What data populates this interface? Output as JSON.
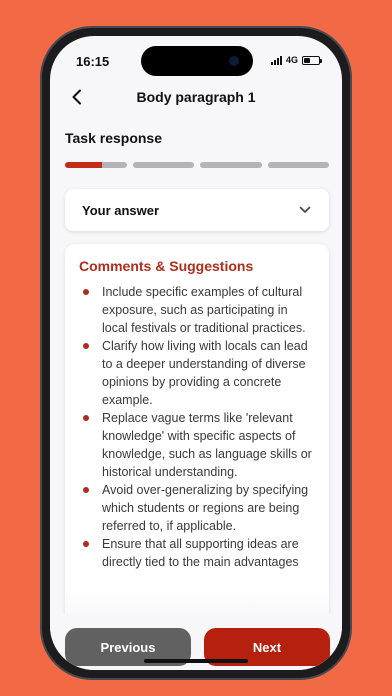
{
  "status_bar": {
    "time": "16:15",
    "network": "4G"
  },
  "header": {
    "title": "Body paragraph 1",
    "back_icon": "chevron-left-icon"
  },
  "section": {
    "label": "Task response",
    "progress": {
      "segments": 4,
      "current_segment": 1,
      "current_fill": 0.6,
      "colors": {
        "active": "#c42a18",
        "inactive": "#b3b4ba"
      }
    }
  },
  "answer": {
    "label": "Your answer",
    "toggle_icon": "chevron-down-icon"
  },
  "comments": {
    "title": "Comments & Suggestions",
    "items": [
      "Include specific examples of cultural exposure, such as participating in local festivals or traditional practices.",
      "Clarify how living with locals can lead to a deeper understanding of diverse opinions by providing a concrete example.",
      "Replace vague terms like 'relevant knowledge' with specific aspects of knowledge, such as language skills or historical understanding.",
      "Avoid over-generalizing by specifying which students or regions are being referred to, if applicable.",
      "Ensure that all supporting ideas are directly tied to the main advantages"
    ]
  },
  "footer": {
    "previous_label": "Previous",
    "next_label": "Next"
  },
  "colors": {
    "background": "#f26a45",
    "accent": "#b5200f",
    "secondary_button": "#616161"
  }
}
